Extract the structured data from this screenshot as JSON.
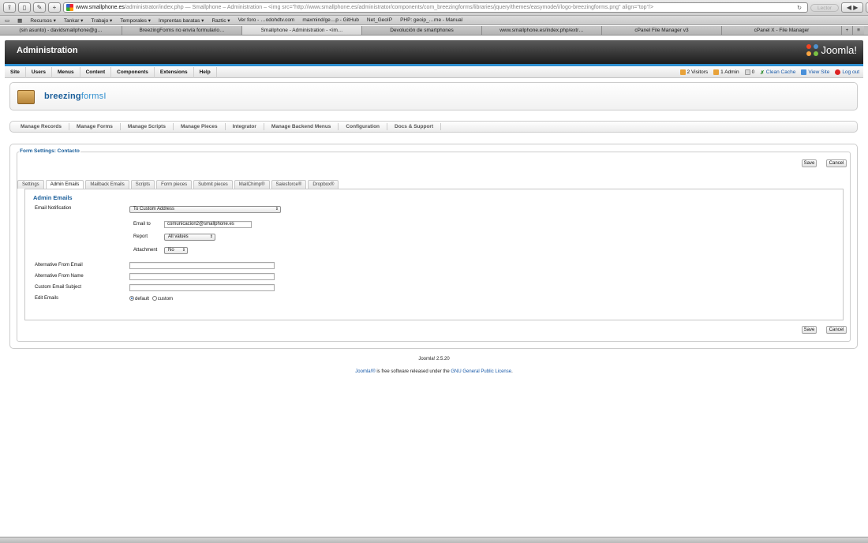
{
  "browser": {
    "url_domain": "www.smallphone.es",
    "url_rest": "/administrator/index.php — Smallphone – Administration – <img src=\"http://www.smallphone.es/administrator/components/com_breezingforms/libraries/jquery/themes/easymode/i/logo-breezingforms.png\" align=\"top\"/>",
    "reader_label": "Lector",
    "bookmarks": [
      "Recursos ▾",
      "Tankar ▾",
      "Trabajo ▾",
      "Temporales ▾",
      "Imprentas baratas ▾",
      "Raztic ▾",
      "Ver foro - …odohdtv.com",
      "maxmind/ge…p - GitHub",
      "Net_GeoIP",
      "PHP: geoip_…me - Manual"
    ],
    "tabs": [
      "(sin asunto) - davidsmallphone@g…",
      "BreezingForms no envía formulario…",
      "Smallphone - Administration - <im…",
      "Devolución de smartphones",
      "www.smallphone.es/index.php/extr…",
      "cPanel File Manager v3",
      "cPanel X - File Manager"
    ],
    "plus": "+",
    "list": "≡"
  },
  "header": {
    "title": "Administration",
    "brand": "Joomla!"
  },
  "menu": {
    "items": [
      "Site",
      "Users",
      "Menus",
      "Content",
      "Components",
      "Extensions",
      "Help"
    ],
    "status": {
      "visitors": "2 Visitors",
      "admin": "1 Admin",
      "messages": "0",
      "clean_cache": "Clean Cache",
      "view_site": "View Site",
      "logout": "Log out"
    }
  },
  "component": {
    "logo_main": "breezing",
    "logo_sub": "forms"
  },
  "subnav": [
    "Manage Records",
    "Manage Forms",
    "Manage Scripts",
    "Manage Pieces",
    "Integrator",
    "Manage Backend Menus",
    "Configuration",
    "Docs & Support"
  ],
  "form": {
    "legend": "Form Settings: Contacto",
    "save": "Save",
    "cancel": "Cancel",
    "tabs": [
      "Settings",
      "Admin Emails",
      "Mailback Emails",
      "Scripts",
      "Form pieces",
      "Submit pieces",
      "MailChimp®",
      "Salesforce®",
      "Dropbox®"
    ],
    "active_tab": "Admin Emails",
    "panel_title": "Admin Emails",
    "email_notification_label": "Email Notification",
    "email_notification_value": "To Custom Address",
    "email_to_label": "Email to",
    "email_to_value": "comunicacion2@smallphone.es",
    "report_label": "Report",
    "report_value": "All values",
    "attachment_label": "Attachment",
    "attachment_value": "No",
    "alt_from_email_label": "Alternative From Email",
    "alt_from_email_value": "",
    "alt_from_name_label": "Alternative From Name",
    "alt_from_name_value": "",
    "custom_subject_label": "Custom Email Subject",
    "custom_subject_value": "",
    "edit_emails_label": "Edit Emails",
    "edit_default": "default",
    "edit_custom": "custom"
  },
  "footer": {
    "version": "Joomla! 2.5.20",
    "brand_link": "Joomla!®",
    "license_text": " is free software released under the ",
    "license_link": "GNU General Public License",
    "period": "."
  },
  "colors": {
    "accent": "#2f8fd0",
    "link": "#1859a8",
    "header_bg": "#2a2a2a"
  }
}
